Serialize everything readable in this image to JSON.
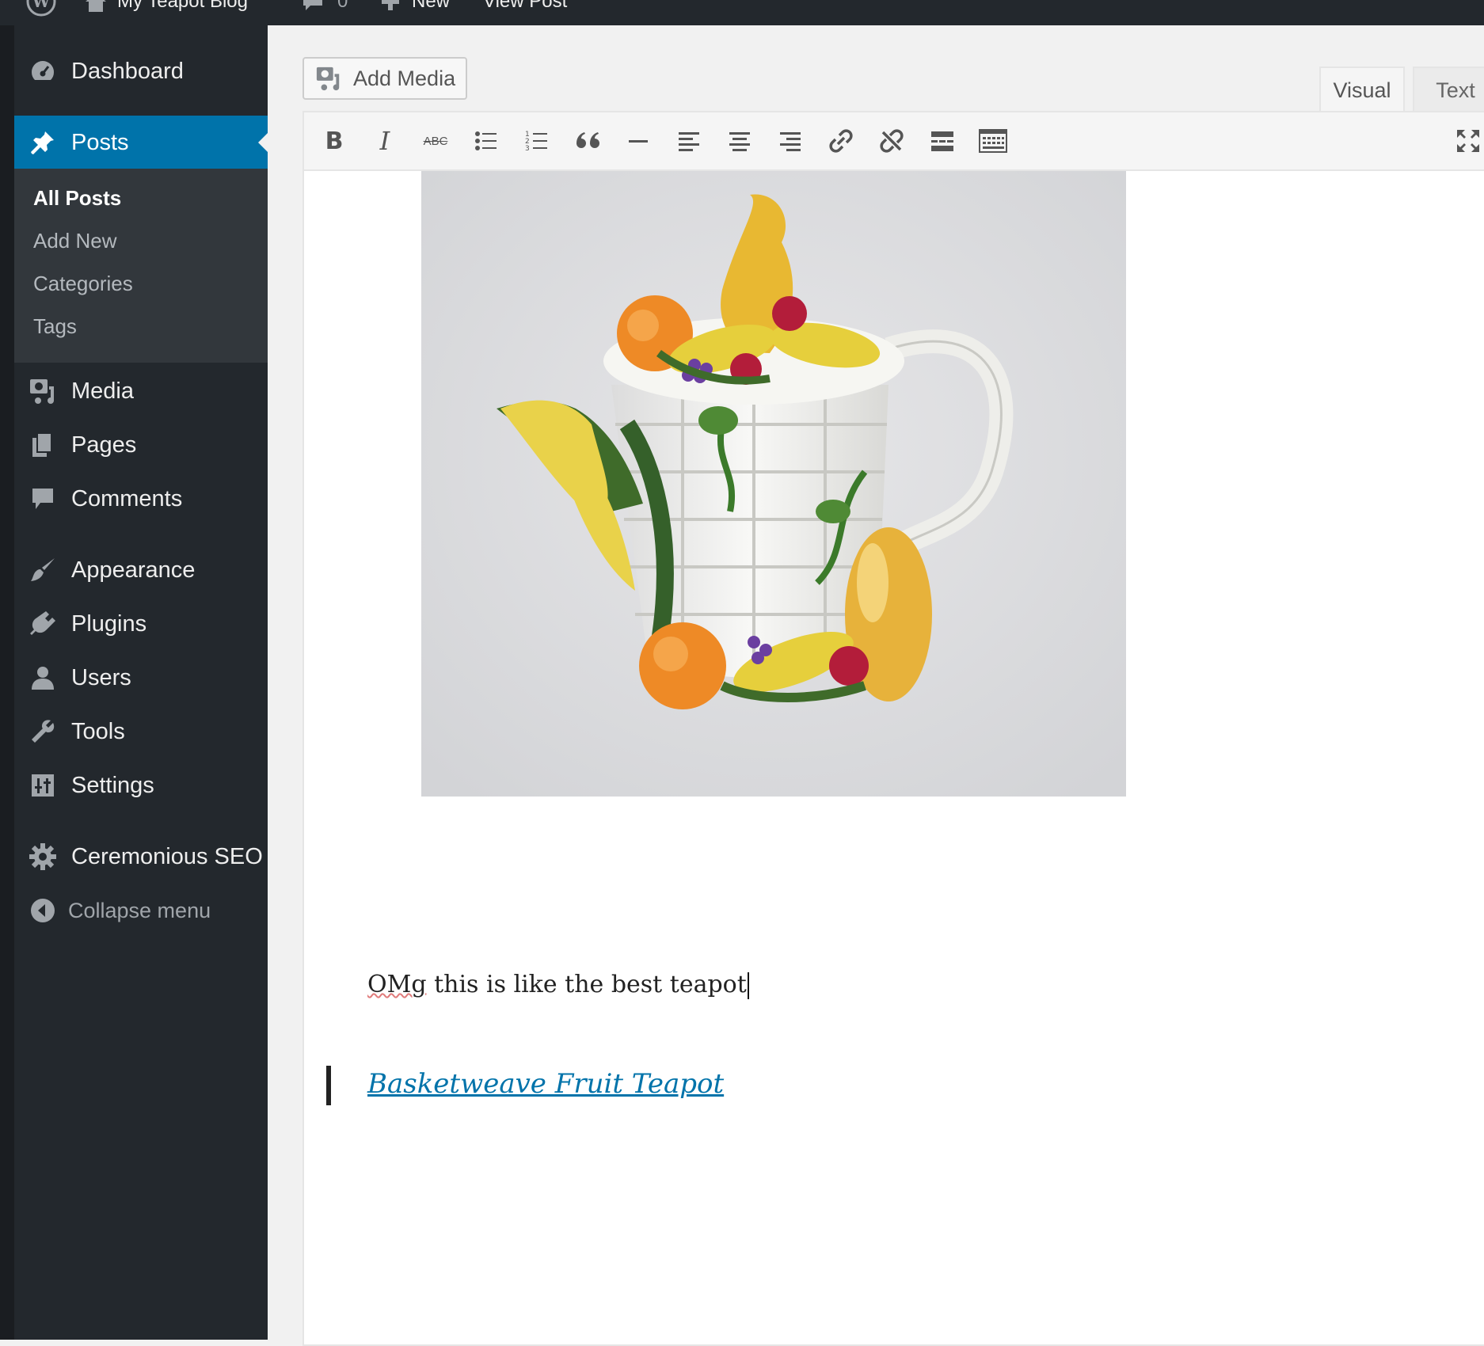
{
  "admin_bar": {
    "site_name": "My Teapot Blog",
    "comments_count": "0",
    "new_label": "New",
    "view_post_label": "View Post"
  },
  "sidebar": {
    "items": [
      {
        "label": "Dashboard",
        "icon": "dashboard-icon"
      },
      {
        "label": "Posts",
        "icon": "pushpin-icon",
        "active": true
      },
      {
        "label": "Media",
        "icon": "media-icon"
      },
      {
        "label": "Pages",
        "icon": "pages-icon"
      },
      {
        "label": "Comments",
        "icon": "comment-icon"
      },
      {
        "label": "Appearance",
        "icon": "paintbrush-icon"
      },
      {
        "label": "Plugins",
        "icon": "plugin-icon"
      },
      {
        "label": "Users",
        "icon": "user-icon"
      },
      {
        "label": "Tools",
        "icon": "wrench-icon"
      },
      {
        "label": "Settings",
        "icon": "settings-icon"
      },
      {
        "label": "Ceremonious SEO",
        "icon": "gear-icon"
      }
    ],
    "posts_submenu": [
      "All Posts",
      "Add New",
      "Categories",
      "Tags"
    ],
    "collapse_label": "Collapse menu"
  },
  "editor": {
    "add_media_label": "Add Media",
    "tabs": {
      "visual": "Visual",
      "text": "Text"
    },
    "toolbar": {
      "strikethrough_label": "ABC",
      "bold_label": "B",
      "italic_label": "I"
    },
    "content": {
      "paragraph_misspelled": "OMg",
      "paragraph_rest": " this is like the best teapot",
      "blockquote_link": "Basketweave Fruit Teapot"
    }
  },
  "colors": {
    "admin_bar": "#23282d",
    "sidebar": "#23282d",
    "active_menu": "#0073aa",
    "link": "#0073aa"
  }
}
